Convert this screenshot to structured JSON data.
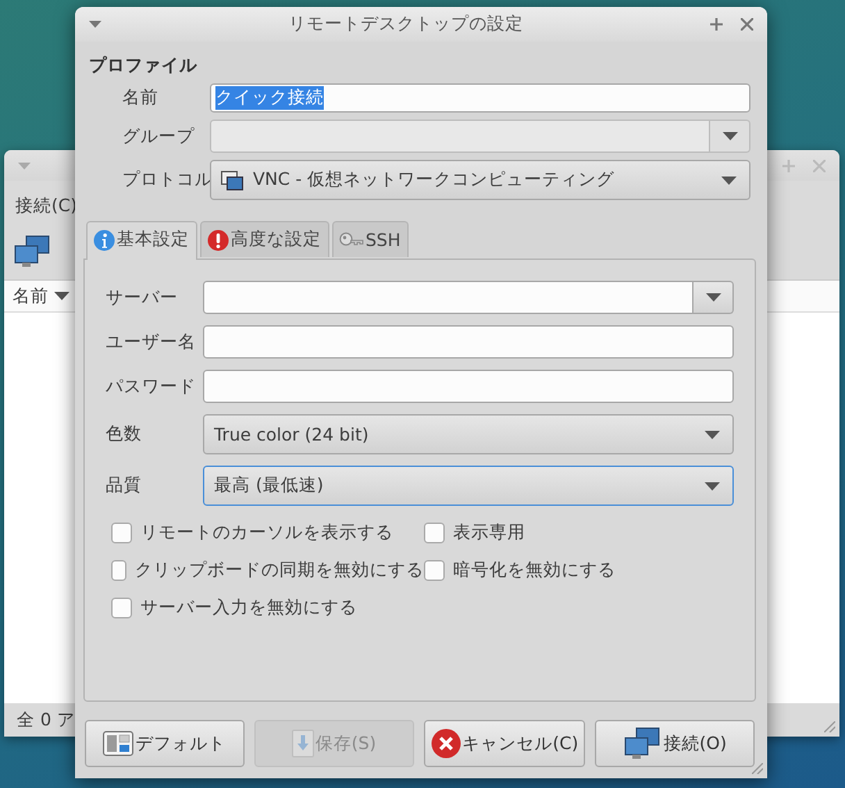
{
  "back_window": {
    "menu": [
      "接続(C)"
    ],
    "list_column": "名前",
    "status": "全 0 ア"
  },
  "dialog": {
    "title": "リモートデスクトップの設定",
    "section": "プロファイル",
    "profile": [
      {
        "kind": "entry",
        "label": "名前",
        "value": "クイック接続",
        "text_selected": true,
        "disabled": false,
        "focused": false
      },
      {
        "kind": "combo-entry",
        "label": "グループ",
        "disabled": true,
        "focused": false
      },
      {
        "kind": "combo",
        "label": "プロトコル",
        "value": "VNC - 仮想ネットワークコンピューティング",
        "disabled": false,
        "focused": false
      }
    ],
    "tabs": [
      {
        "label": "基本設定",
        "selected": true
      },
      {
        "label": "高度な設定",
        "selected": false
      },
      {
        "label": "SSH",
        "selected": false
      }
    ],
    "settings": [
      {
        "kind": "combo-entry",
        "label": "サーバー",
        "disabled": false,
        "focused": false
      },
      {
        "kind": "entry",
        "label": "ユーザー名",
        "disabled": false,
        "focused": false
      },
      {
        "kind": "entry",
        "label": "パスワード",
        "disabled": false,
        "focused": false
      },
      {
        "kind": "combo",
        "label": "色数",
        "value": "True color (24 bit)",
        "disabled": false,
        "focused": false
      },
      {
        "kind": "combo",
        "label": "品質",
        "value": "最高 (最低速)",
        "disabled": false,
        "focused": true
      }
    ],
    "options": [
      {
        "label": "リモートのカーソルを表示する",
        "checked": false
      },
      {
        "label": "表示専用",
        "checked": false
      },
      {
        "label": "クリップボードの同期を無効にする",
        "checked": false
      },
      {
        "label": "暗号化を無効にする",
        "checked": false
      },
      {
        "label": "サーバー入力を無効にする",
        "checked": false
      }
    ],
    "buttons": [
      {
        "label": "デフォルト",
        "disabled": false
      },
      {
        "label": "保存(S)",
        "disabled": true
      },
      {
        "label": "キャンセル(C)",
        "disabled": false
      },
      {
        "label": "接続(O)",
        "disabled": false
      }
    ]
  }
}
